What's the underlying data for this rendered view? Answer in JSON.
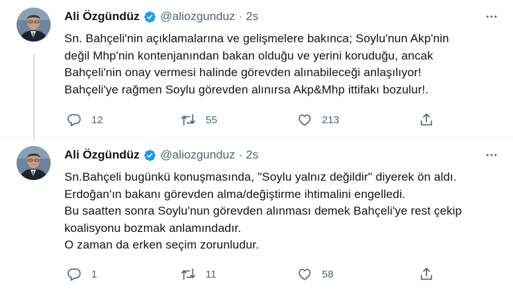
{
  "tweets": [
    {
      "author": {
        "name": "Ali Özgündüz",
        "handle": "@aliozgunduz"
      },
      "separator": "·",
      "time": "2s",
      "lines": [
        "Sn. Bahçeli'nin açıklamalarına ve gelişmelere bakınca; Soylu'nun Akp'nin",
        "değil Mhp'nin kontenjanından bakan olduğu ve yerini koruduğu, ancak",
        "Bahçeli'nin onay vermesi halinde görevden alınabileceği anlaşılıyor!",
        "Bahçeli'ye rağmen Soylu görevden alınırsa Akp&Mhp ittifakı bozulur!."
      ],
      "counts": {
        "replies": "12",
        "retweets": "55",
        "likes": "213"
      }
    },
    {
      "author": {
        "name": "Ali Özgündüz",
        "handle": "@aliozgunduz"
      },
      "separator": "·",
      "time": "2s",
      "lines": [
        "Sn.Bahçeli bugünkü konuşmasında, \"Soylu yalnız değildir\" diyerek ön aldı.",
        "Erdoğan'ın bakanı görevden alma/değiştirme ihtimalini engelledi.",
        "Bu saatten sonra Soylu'nun görevden alınması demek Bahçeli'ye rest çekip",
        "koalisyonu bozmak anlamındadır.",
        "O zaman da erken seçim zorunludur."
      ],
      "counts": {
        "replies": "1",
        "retweets": "11",
        "likes": "58"
      }
    }
  ],
  "colors": {
    "verified": "#1d9bf0",
    "secondary_text": "#536471",
    "thread_line": "#cfd9de"
  },
  "icons": {
    "reply": "reply-icon",
    "retweet": "retweet-icon",
    "like": "heart-icon",
    "share": "share-icon",
    "more": "more-icon",
    "verified": "verified-badge-icon"
  }
}
